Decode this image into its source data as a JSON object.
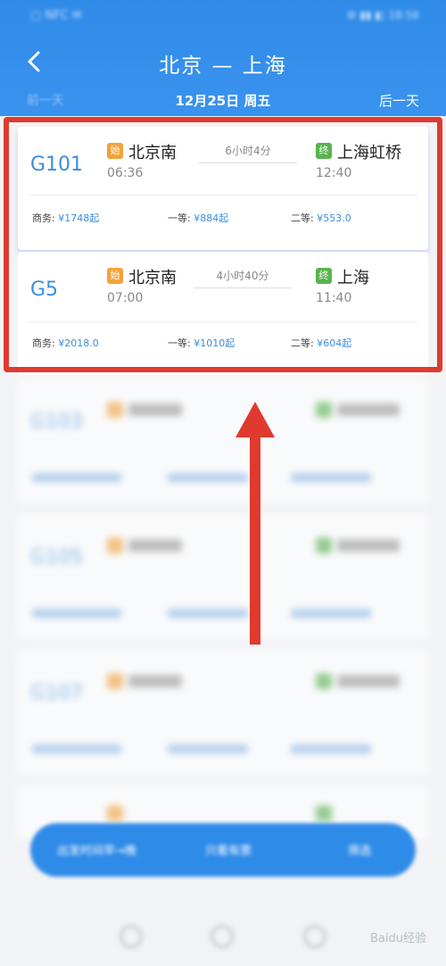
{
  "status_bar": {
    "left_text": "▢ NFC ✉",
    "right_text": "⚙ ▮▮ ◧ 18:56"
  },
  "header": {
    "route_title": "北京 — 上海",
    "prev_day_label": "前一天",
    "date_label": "12月25日 周五",
    "next_day_label": "后一天"
  },
  "trains": [
    {
      "train_no": "G101",
      "from_tag": "始",
      "from_station": "北京南",
      "depart_time": "06:36",
      "duration": "6小时4分",
      "to_tag": "终",
      "to_station": "上海虹桥",
      "arrive_time": "12:40",
      "seats": [
        {
          "label": "商务:",
          "price": "¥1748起"
        },
        {
          "label": "一等:",
          "price": "¥884起"
        },
        {
          "label": "二等:",
          "price": "¥553.0"
        }
      ]
    },
    {
      "train_no": "G5",
      "from_tag": "始",
      "from_station": "北京南",
      "depart_time": "07:00",
      "duration": "4小时40分",
      "to_tag": "终",
      "to_station": "上海",
      "arrive_time": "11:40",
      "seats": [
        {
          "label": "商务:",
          "price": "¥2018.0"
        },
        {
          "label": "一等:",
          "price": "¥1010起"
        },
        {
          "label": "二等:",
          "price": "¥604起"
        }
      ]
    }
  ],
  "blurred_trains": [
    "G103",
    "G105",
    "G107"
  ],
  "bottom_bar": {
    "items": [
      "出发时间早→晚",
      "只看有票",
      "筛选"
    ]
  },
  "watermark": "Baidu经验",
  "colors": {
    "header_blue": "#2f8be8",
    "highlight_red": "#e03a2f",
    "price_blue": "#3b8ede",
    "tag_orange": "#f5a13b",
    "tag_green": "#58b44d"
  }
}
